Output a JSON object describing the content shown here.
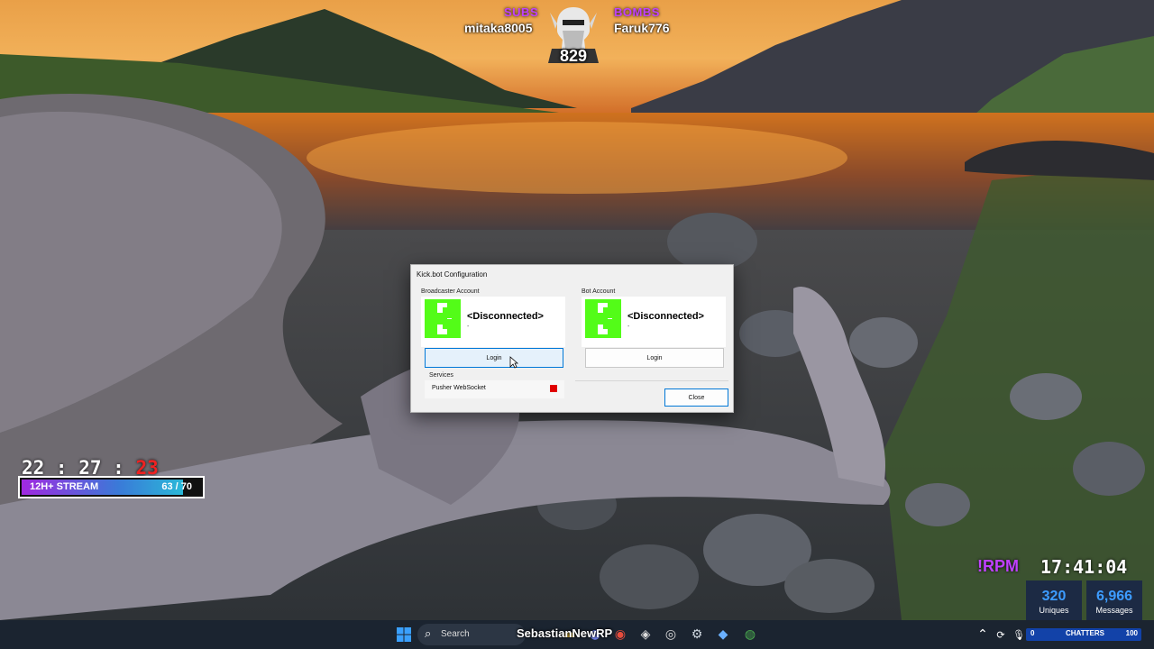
{
  "overlay": {
    "subs_label": "SUBS",
    "bombs_label": "BOMBS",
    "subs_name": "mitaka8005",
    "bombs_name": "Faruk776",
    "counter": "829",
    "clock_left_hm": "22 : 27 : ",
    "clock_left_s": "23",
    "stream_label": "12H+ STREAM",
    "stream_count": "63 / 70",
    "stream_progress": 0.9,
    "rpm": "!RPM",
    "clock_right": "17:41:04",
    "uniques_value": "320",
    "uniques_label": "Uniques",
    "messages_value": "6,966",
    "messages_label": "Messages",
    "chatters_min": "0",
    "chatters_label": "CHATTERS",
    "chatters_max": "100",
    "taskbar_name": "SebastianNewRP"
  },
  "dialog": {
    "title": "Kick.bot Configuration",
    "broadcaster": {
      "label": "Broadcaster Account",
      "status": "<Disconnected>",
      "sub": "-",
      "login_label": "Login"
    },
    "bot": {
      "label": "Bot Account",
      "status": "<Disconnected>",
      "sub": "-",
      "login_label": "Login"
    },
    "services_label": "Services",
    "service_name": "Pusher WebSocket",
    "service_status_color": "#e00000",
    "close_label": "Close"
  },
  "taskbar": {
    "search_placeholder": "Search",
    "start_icon": "windows-start-icon",
    "search_icon": "search-icon"
  },
  "colors": {
    "kick_green": "#53fc18",
    "overlay_purple": "#c040ff",
    "stat_blue": "#3d9cff",
    "taskbar": "#1b2430"
  }
}
